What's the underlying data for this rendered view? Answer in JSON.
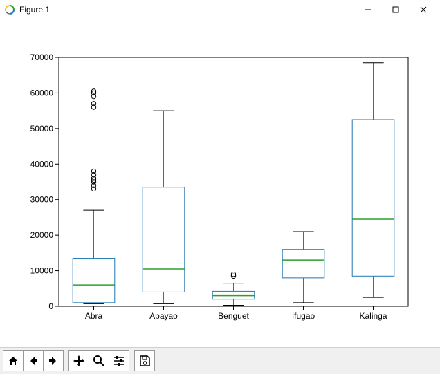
{
  "window": {
    "title": "Figure 1",
    "controls": {
      "minimize": "—",
      "maximize": "□",
      "close": "✕"
    }
  },
  "toolbar": {
    "home": "Home",
    "back": "Back",
    "forward": "Forward",
    "pan": "Pan",
    "zoom": "Zoom",
    "configure": "Configure subplots",
    "save": "Save"
  },
  "chart_data": {
    "type": "boxplot",
    "categories": [
      "Abra",
      "Apayao",
      "Benguet",
      "Ifugao",
      "Kalinga"
    ],
    "ylabel": "",
    "xlabel": "",
    "ylim": [
      0,
      70000
    ],
    "yticks": [
      0,
      10000,
      20000,
      30000,
      40000,
      50000,
      60000,
      70000
    ],
    "ytick_labels": [
      "0",
      "10000",
      "20000",
      "30000",
      "40000",
      "50000",
      "60000",
      "70000"
    ],
    "series": [
      {
        "name": "Abra",
        "q1": 1000,
        "median": 6000,
        "q3": 13500,
        "whisker_low": 700,
        "whisker_high": 27000,
        "outliers": [
          33000,
          34000,
          35000,
          35500,
          36000,
          37000,
          38000,
          56000,
          57000,
          59000,
          60000,
          60500
        ]
      },
      {
        "name": "Apayao",
        "q1": 4000,
        "median": 10500,
        "q3": 33500,
        "whisker_low": 700,
        "whisker_high": 55000,
        "outliers": []
      },
      {
        "name": "Benguet",
        "q1": 2000,
        "median": 3000,
        "q3": 4200,
        "whisker_low": 300,
        "whisker_high": 6500,
        "outliers": [
          8500,
          9000
        ]
      },
      {
        "name": "Ifugao",
        "q1": 8000,
        "median": 13000,
        "q3": 16000,
        "whisker_low": 1000,
        "whisker_high": 21000,
        "outliers": []
      },
      {
        "name": "Kalinga",
        "q1": 8500,
        "median": 24500,
        "q3": 52500,
        "whisker_low": 2500,
        "whisker_high": 68500,
        "outliers": []
      }
    ],
    "colors": {
      "box_edge": "#1f77b4",
      "median": "#2ca02c",
      "whisker": "#1f77b4",
      "outlier_stroke": "#000000",
      "outlier_fill": "none",
      "axis": "#000000"
    }
  }
}
